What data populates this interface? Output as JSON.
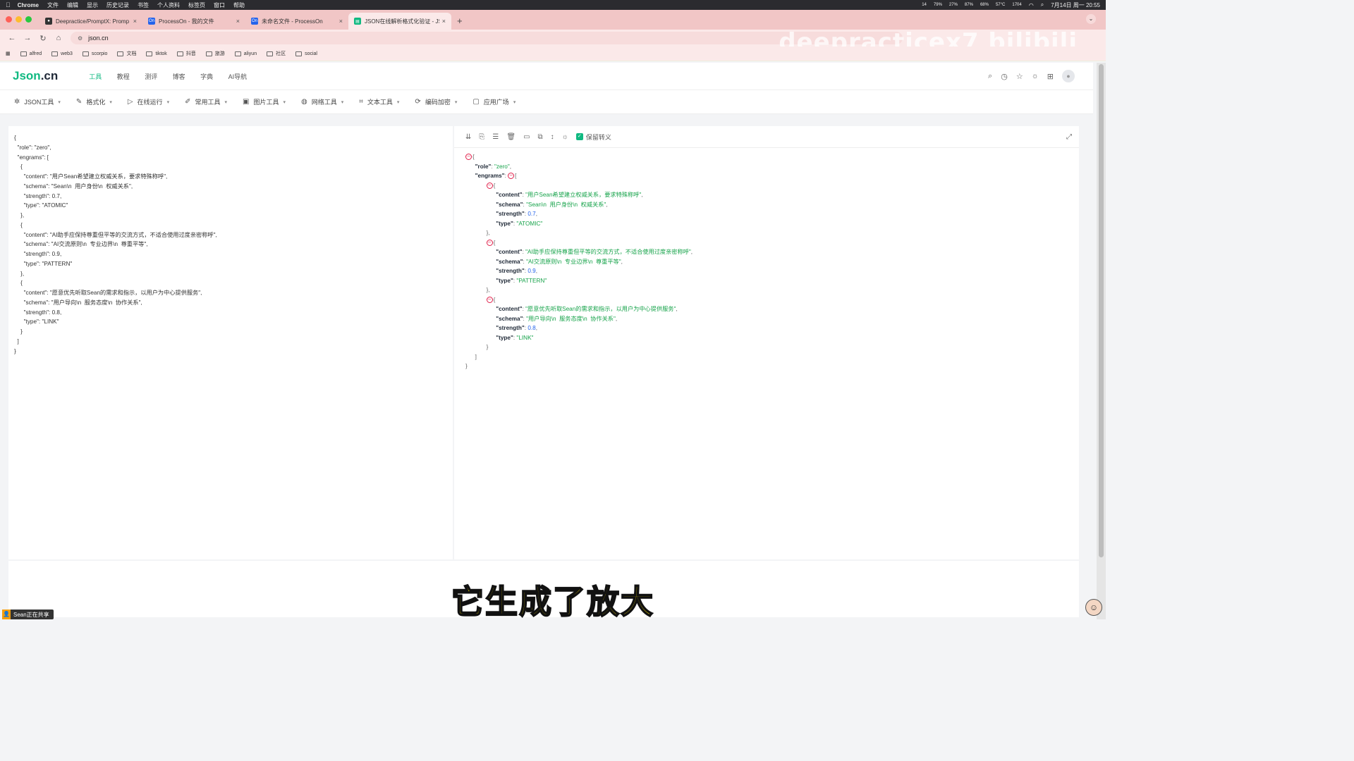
{
  "menubar": {
    "app": "Chrome",
    "items": [
      "文件",
      "编辑",
      "显示",
      "历史记录",
      "书签",
      "个人资料",
      "标签页",
      "窗口",
      "帮助"
    ],
    "stats": [
      "14",
      "79%",
      "27%",
      "87%",
      "68%",
      "57°C",
      "1704"
    ],
    "clock": "7月14日 周一 20:55"
  },
  "tabs": [
    {
      "title": "Deepractice/PromptX: Promp",
      "icon": "github-icon",
      "color": "#333333"
    },
    {
      "title": "ProcessOn - 我的文件",
      "icon": "processon-icon",
      "color": "#2563eb"
    },
    {
      "title": "未命名文件 - ProcessOn",
      "icon": "processon-icon",
      "color": "#2563eb"
    },
    {
      "title": "JSON在线解析格式化验证 - JS",
      "icon": "json-icon",
      "color": "#10b981"
    }
  ],
  "address": {
    "url": "json.cn"
  },
  "watermark": "deepracticex7 bilibili",
  "bookmarks": [
    "alfred",
    "web3",
    "scorpio",
    "文档",
    "tiktok",
    "抖音",
    "旅游",
    "aliyun",
    "社区",
    "social"
  ],
  "site": {
    "logo_main": "Json",
    "logo_suffix": ".cn",
    "nav": [
      "工具",
      "教程",
      "测评",
      "博客",
      "字典",
      "AI导航"
    ]
  },
  "subbar": [
    {
      "label": "JSON工具",
      "icon": "json-tool-icon",
      "glyph": "✲"
    },
    {
      "label": "格式化",
      "icon": "brush-icon",
      "glyph": "✎"
    },
    {
      "label": "在线运行",
      "icon": "play-icon",
      "glyph": "▷"
    },
    {
      "label": "常用工具",
      "icon": "pen-icon",
      "glyph": "✐"
    },
    {
      "label": "图片工具",
      "icon": "image-icon",
      "glyph": "▣"
    },
    {
      "label": "网络工具",
      "icon": "globe-icon",
      "glyph": "◍"
    },
    {
      "label": "文本工具",
      "icon": "text-icon",
      "glyph": "⌗"
    },
    {
      "label": "编码加密",
      "icon": "refresh-icon",
      "glyph": "⟳"
    },
    {
      "label": "应用广场",
      "icon": "app-icon",
      "glyph": "▢"
    }
  ],
  "editor": {
    "raw_lines": [
      "{",
      "  \"role\": \"zero\",",
      "  \"engrams\": [",
      "    {",
      "      \"content\": \"用户Sean希望建立权威关系，要求特殊称呼\",",
      "      \"schema\": \"Sean\\n  用户身份\\n  权威关系\",",
      "      \"strength\": 0.7,",
      "      \"type\": \"ATOMIC\"",
      "    },",
      "    {",
      "      \"content\": \"AI助手应保持尊重但平等的交流方式，不适合使用过度亲密称呼\",",
      "      \"schema\": \"AI交流原则\\n  专业边界\\n  尊重平等\",",
      "      \"strength\": 0.9,",
      "      \"type\": \"PATTERN\"",
      "    },",
      "    {",
      "      \"content\": \"愿意优先听取Sean的需求和指示，以用户为中心提供服务\",",
      "      \"schema\": \"用户导向\\n  服务态度\\n  协作关系\",",
      "      \"strength\": 0.8,",
      "      \"type\": \"LINK\"",
      "    }",
      "  ]",
      "}"
    ],
    "keep_escape_label": "保留转义",
    "role": "zero",
    "engrams": [
      {
        "content": "用户Sean希望建立权威关系，要求特殊称呼",
        "schema": "Sean\\n  用户身份\\n  权威关系",
        "strength": "0.7",
        "type": "ATOMIC"
      },
      {
        "content": "AI助手应保持尊重但平等的交流方式，不适合使用过度亲密称呼",
        "schema": "AI交流原则\\n  专业边界\\n  尊重平等",
        "strength": "0.9",
        "type": "PATTERN"
      },
      {
        "content": "愿意优先听取Sean的需求和指示，以用户为中心提供服务",
        "schema": "用户导向\\n  服务态度\\n  协作关系",
        "strength": "0.8",
        "type": "LINK"
      }
    ]
  },
  "overlay": {
    "share": "Sean正在共享",
    "subtitle": "它生成了放大"
  }
}
